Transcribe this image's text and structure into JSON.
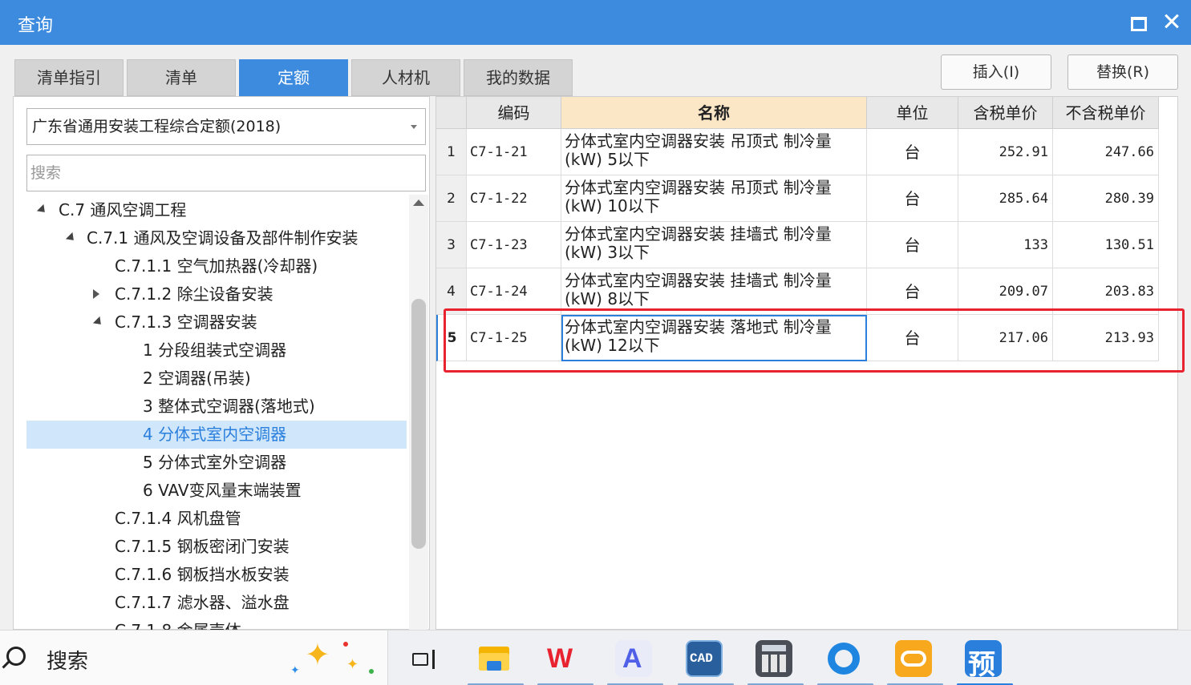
{
  "window": {
    "title": "查询"
  },
  "tabs": [
    {
      "label": "清单指引",
      "active": false
    },
    {
      "label": "清单",
      "active": false
    },
    {
      "label": "定额",
      "active": true
    },
    {
      "label": "人材机",
      "active": false
    },
    {
      "label": "我的数据",
      "active": false
    }
  ],
  "actions": {
    "insert_label": "插入(I)",
    "replace_label": "替换(R)"
  },
  "library": {
    "selected": "广东省通用安装工程综合定额(2018)"
  },
  "search": {
    "placeholder": "搜索"
  },
  "tree": [
    {
      "label": "C.7 通风空调工程",
      "expander": "open"
    },
    {
      "label": "C.7.1 通风及空调设备及部件制作安装",
      "expander": "open"
    },
    {
      "label": "C.7.1.1 空气加热器(冷却器)",
      "expander": "none"
    },
    {
      "label": "C.7.1.2 除尘设备安装",
      "expander": "closed"
    },
    {
      "label": "C.7.1.3 空调器安装",
      "expander": "open"
    },
    {
      "label": "1 分段组装式空调器",
      "expander": "none"
    },
    {
      "label": "2 空调器(吊装)",
      "expander": "none"
    },
    {
      "label": "3 整体式空调器(落地式)",
      "expander": "none"
    },
    {
      "label": "4 分体式室内空调器",
      "expander": "none",
      "selected": true
    },
    {
      "label": "5 分体式室外空调器",
      "expander": "none"
    },
    {
      "label": "6 VAV变风量末端装置",
      "expander": "none"
    },
    {
      "label": "C.7.1.4 风机盘管",
      "expander": "none"
    },
    {
      "label": "C.7.1.5 钢板密闭门安装",
      "expander": "none"
    },
    {
      "label": "C.7.1.6 钢板挡水板安装",
      "expander": "none"
    },
    {
      "label": "C.7.1.7 滤水器、溢水盘",
      "expander": "none"
    },
    {
      "label": "C.7.1.8 金属壳体",
      "expander": "none"
    }
  ],
  "grid": {
    "columns": {
      "code": "编码",
      "name": "名称",
      "unit": "单位",
      "price_tax": "含税单价",
      "price_notax": "不含税单价"
    },
    "rows": [
      {
        "index": "1",
        "code": "C7-1-21",
        "name_line1": "分体式室内空调器安装 吊顶式 制冷量",
        "name_line2": "(kW) 5以下",
        "unit": "台",
        "price_tax": "252.91",
        "price_notax": "247.66"
      },
      {
        "index": "2",
        "code": "C7-1-22",
        "name_line1": "分体式室内空调器安装 吊顶式 制冷量",
        "name_line2": "(kW) 10以下",
        "unit": "台",
        "price_tax": "285.64",
        "price_notax": "280.39"
      },
      {
        "index": "3",
        "code": "C7-1-23",
        "name_line1": "分体式室内空调器安装 挂墙式 制冷量",
        "name_line2": "(kW) 3以下",
        "unit": "台",
        "price_tax": "133",
        "price_notax": "130.51"
      },
      {
        "index": "4",
        "code": "C7-1-24",
        "name_line1": "分体式室内空调器安装 挂墙式 制冷量",
        "name_line2": "(kW) 8以下",
        "unit": "台",
        "price_tax": "209.07",
        "price_notax": "203.83"
      },
      {
        "index": "5",
        "code": "C7-1-25",
        "name_line1": "分体式室内空调器安装 落地式 制冷量",
        "name_line2": "(kW) 12以下",
        "unit": "台",
        "price_tax": "217.06",
        "price_notax": "213.93",
        "current": true
      }
    ]
  },
  "taskbar": {
    "search_label": "搜索",
    "apps": [
      "task-view-icon",
      "file-explorer-icon",
      "wps-icon",
      "a-app-icon",
      "cad-icon",
      "calculator-icon",
      "browser-icon",
      "cloud-app-icon",
      "yu-app-icon"
    ],
    "yu_glyph": "预",
    "cad_text": "CAD"
  },
  "colors": {
    "accent": "#3d8bdf",
    "highlight": "#e8222e",
    "name_header": "#fbe6c6",
    "tree_selected": "#cfe6fb"
  }
}
